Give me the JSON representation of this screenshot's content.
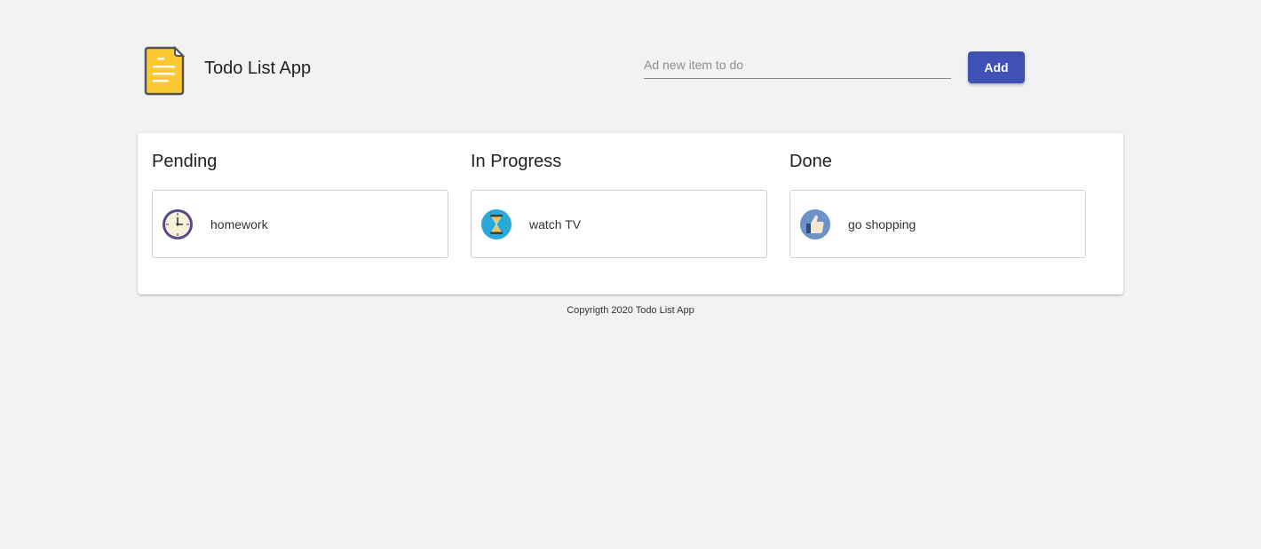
{
  "header": {
    "title": "Todo List App",
    "logo_icon": "document-note-icon",
    "input_placeholder": "Ad new item to do",
    "input_value": "",
    "add_label": "Add"
  },
  "columns": [
    {
      "title": "Pending",
      "tasks": [
        {
          "label": "homework",
          "icon": "clock-icon"
        }
      ]
    },
    {
      "title": "In Progress",
      "tasks": [
        {
          "label": "watch TV",
          "icon": "hourglass-icon"
        }
      ]
    },
    {
      "title": "Done",
      "tasks": [
        {
          "label": "go shopping",
          "icon": "thumbs-up-icon"
        }
      ]
    }
  ],
  "footer": {
    "text": "Copyrigth 2020 Todo List App"
  },
  "colors": {
    "accent": "#3f51b5",
    "background": "#f2f2f2",
    "logo": "#fcc934"
  }
}
